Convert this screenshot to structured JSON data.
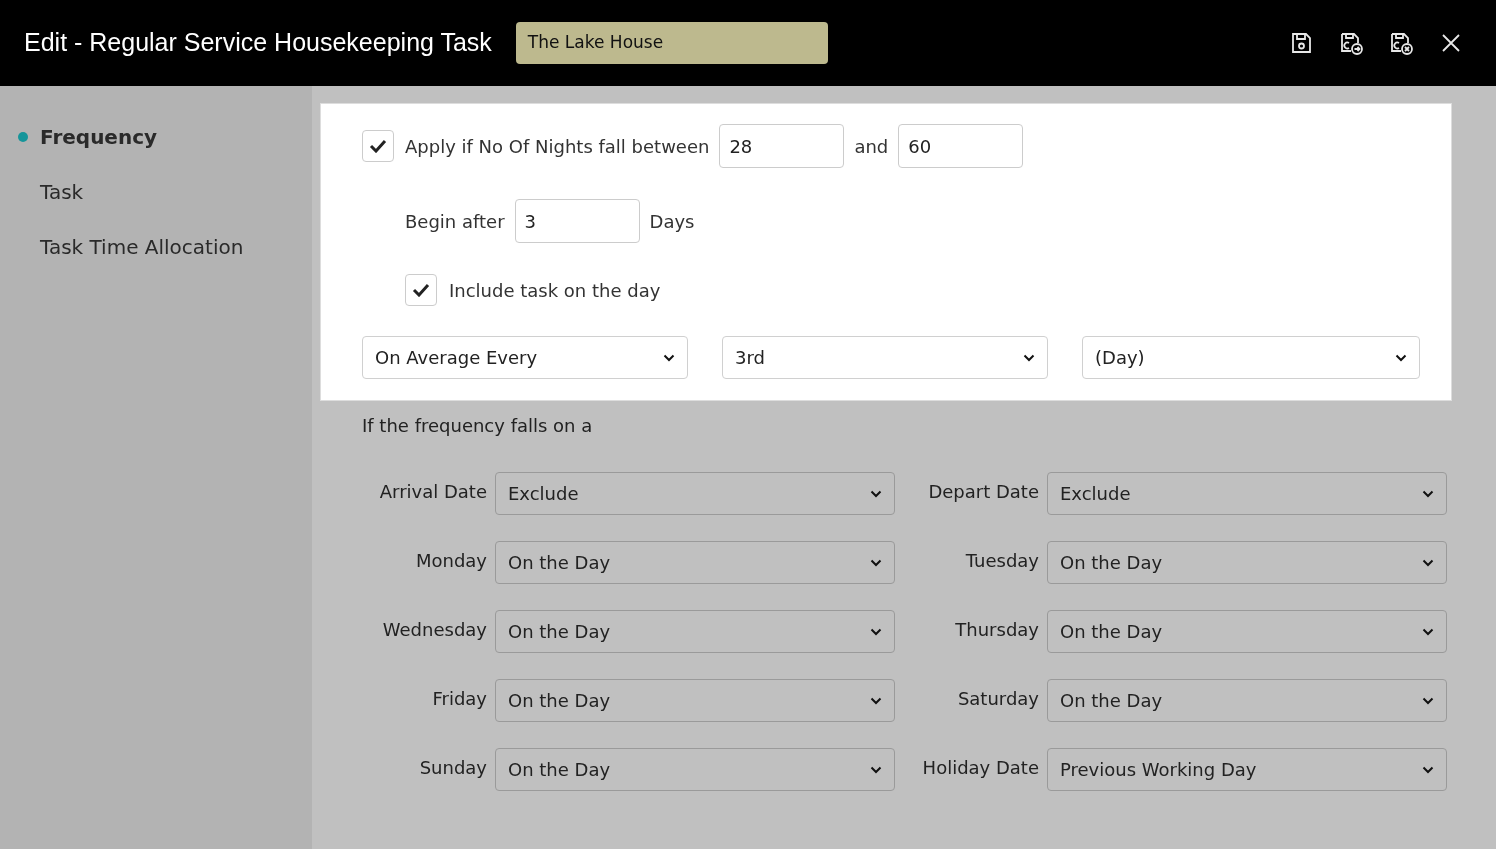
{
  "header": {
    "title": "Edit - Regular Service Housekeeping Task",
    "property": "The Lake House"
  },
  "sidebar": {
    "items": [
      {
        "label": "Frequency",
        "selected": true
      },
      {
        "label": "Task",
        "selected": false
      },
      {
        "label": "Task Time Allocation",
        "selected": false
      }
    ]
  },
  "nights": {
    "checked": true,
    "label": "Apply if No Of Nights fall between",
    "from": "28",
    "joiner": "and",
    "to": "60"
  },
  "begin": {
    "label": "Begin after",
    "value": "3",
    "unit": "Days"
  },
  "include": {
    "checked": true,
    "label": "Include task on the day"
  },
  "frequency_selects": [
    "On Average Every",
    "3rd",
    "(Day)"
  ],
  "rules_heading": "If the frequency falls on a",
  "rules": [
    {
      "label": "Arrival Date",
      "value": "Exclude"
    },
    {
      "label": "Depart Date",
      "value": "Exclude"
    },
    {
      "label": "Monday",
      "value": "On the Day"
    },
    {
      "label": "Tuesday",
      "value": "On the Day"
    },
    {
      "label": "Wednesday",
      "value": "On the Day"
    },
    {
      "label": "Thursday",
      "value": "On the Day"
    },
    {
      "label": "Friday",
      "value": "On the Day"
    },
    {
      "label": "Saturday",
      "value": "On the Day"
    },
    {
      "label": "Sunday",
      "value": "On the Day"
    },
    {
      "label": "Holiday Date",
      "value": "Previous Working Day"
    }
  ]
}
